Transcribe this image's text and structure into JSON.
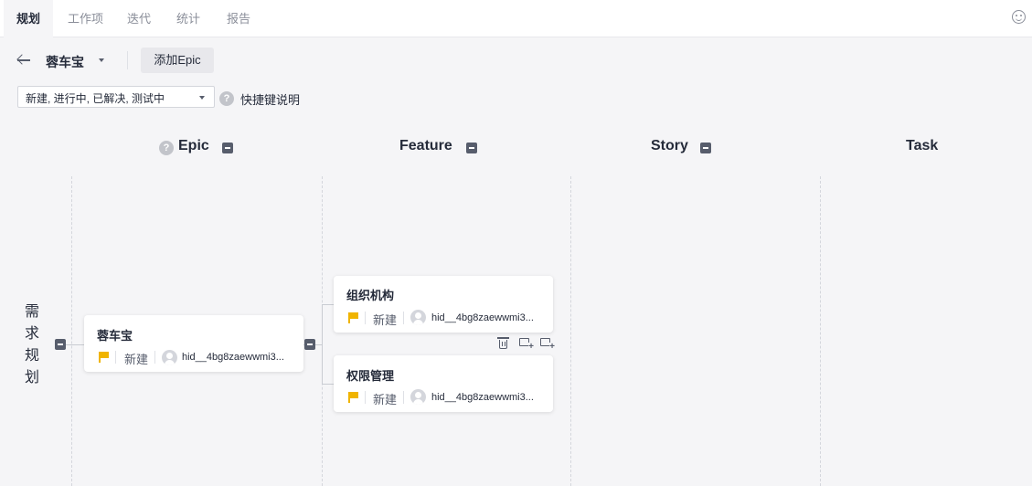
{
  "tabs": [
    {
      "label": "规划",
      "active": true
    },
    {
      "label": "工作项"
    },
    {
      "label": "迭代"
    },
    {
      "label": "统计"
    },
    {
      "label": "报告"
    }
  ],
  "toolbar": {
    "project_name": "蓉车宝",
    "add_epic_label": "添加Epic"
  },
  "filter": {
    "value": "新建, 进行中, 已解决, 测试中",
    "shortcut_label": "快捷键说明",
    "help_glyph": "?"
  },
  "columns": [
    {
      "label": "Epic",
      "has_help": true,
      "collapsible": true
    },
    {
      "label": "Feature",
      "collapsible": true
    },
    {
      "label": "Story",
      "collapsible": true
    },
    {
      "label": "Task",
      "collapsible": false
    }
  ],
  "row_label": "需求规划",
  "epic_card": {
    "title": "蓉车宝",
    "status": "新建",
    "user": "hid__4bg8zaewwmi3..."
  },
  "feature_cards": [
    {
      "title": "组织机构",
      "status": "新建",
      "user": "hid__4bg8zaewwmi3..."
    },
    {
      "title": "权限管理",
      "status": "新建",
      "user": "hid__4bg8zaewwmi3..."
    }
  ],
  "colors": {
    "flag": "#f0b400",
    "background": "#f5f5f7",
    "text": "#252b3a"
  }
}
